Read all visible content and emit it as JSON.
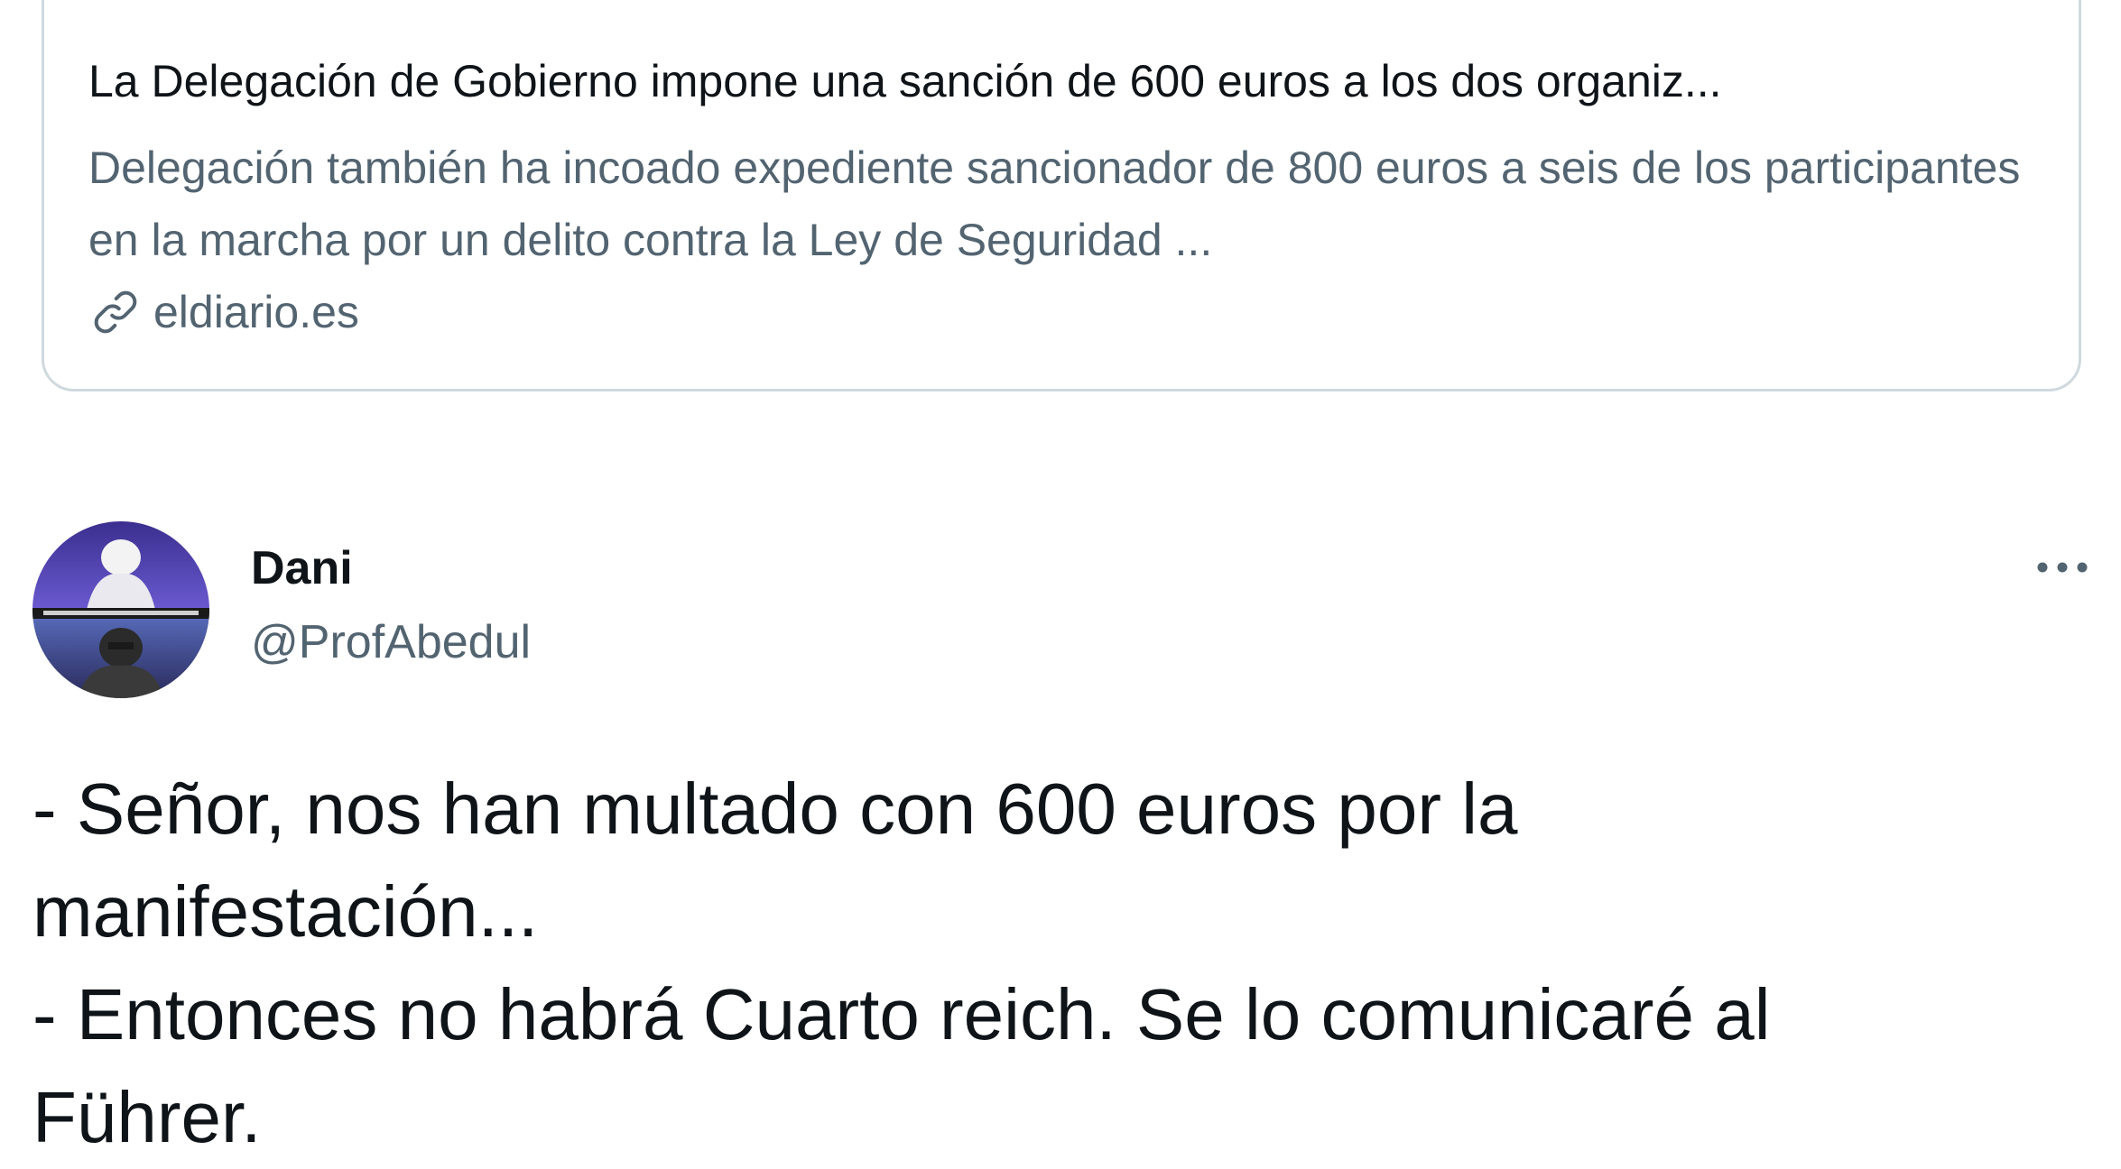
{
  "link_card": {
    "title": "La Delegación de Gobierno impone una sanción de 600 euros a los dos organiz...",
    "description": "Delegación también ha incoado expediente sancionador de 800 euros a seis de los participantes en la marcha por un delito contra la Ley de Seguridad ...",
    "source": "eldiario.es",
    "source_icon": "link-icon"
  },
  "tweet": {
    "author_name": "Dani",
    "author_handle": "@ProfAbedul",
    "more_icon": "more-icon",
    "lines": [
      "- Señor, nos han multado con 600 euros por la",
      "manifestación...",
      "- Entonces no habrá Cuarto reich. Se lo comunicaré al",
      "Führer."
    ]
  },
  "colors": {
    "text_primary": "#0f1419",
    "text_secondary": "#536471",
    "border": "#cfd9de"
  }
}
